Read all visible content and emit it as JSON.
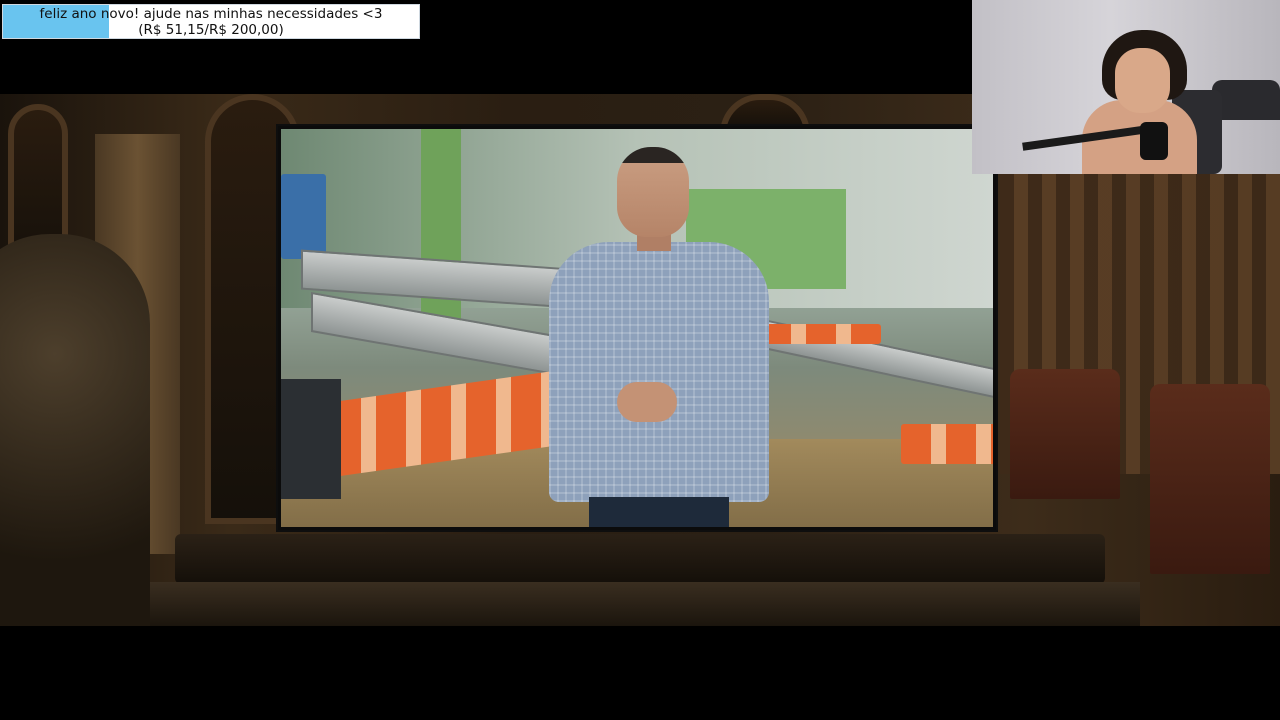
{
  "goal": {
    "message": "feliz ano novo! ajude nas minhas necessidades <3",
    "amount": "(R$ 51,15/R$ 200,00)",
    "progress_fraction": 0.256,
    "fill_color": "#69c4ef"
  },
  "webcam": {
    "icon": "streamer-webcam"
  },
  "video": {
    "scene": "movie-scene-with-tv"
  }
}
